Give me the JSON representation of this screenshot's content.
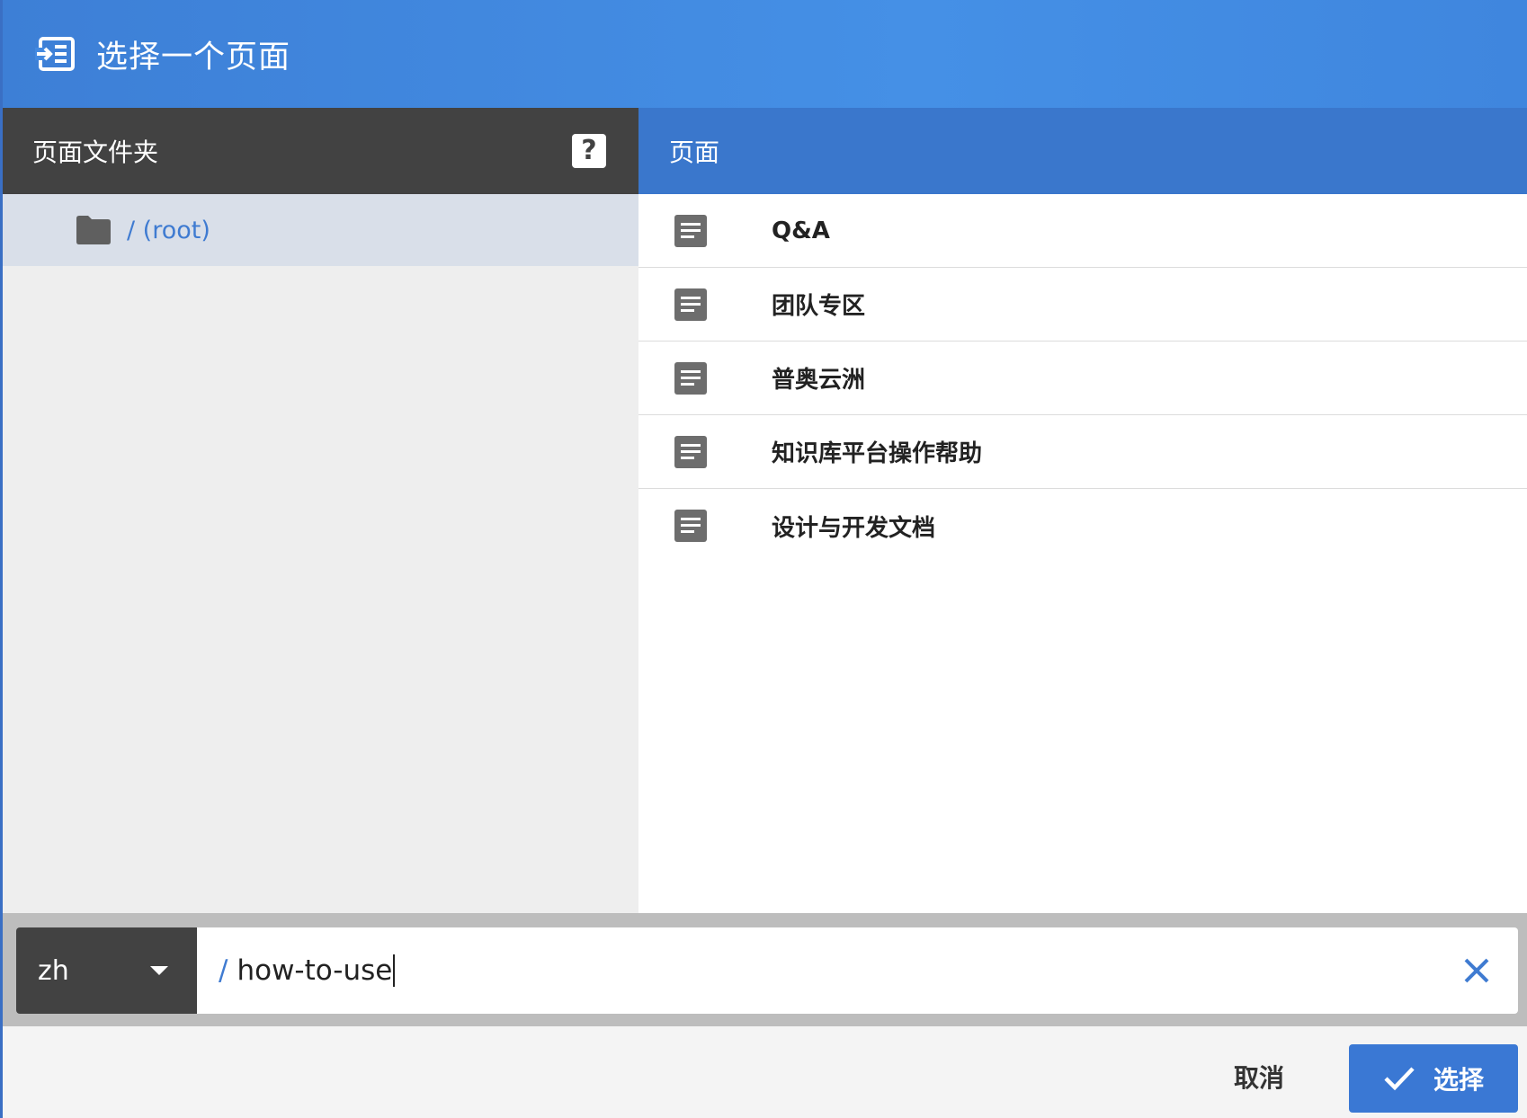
{
  "dialog": {
    "title": "选择一个页面",
    "title_icon": "move-to-folder-icon"
  },
  "folders_panel": {
    "header": "页面文件夹",
    "help_icon": "help-icon",
    "items": [
      {
        "label": "/ (root)",
        "icon": "folder-icon",
        "selected": true
      }
    ]
  },
  "pages_panel": {
    "header": "页面",
    "items": [
      {
        "label": "Q&A",
        "icon": "document-icon"
      },
      {
        "label": "团队专区",
        "icon": "document-icon"
      },
      {
        "label": "普奥云洲",
        "icon": "document-icon"
      },
      {
        "label": "知识库平台操作帮助",
        "icon": "document-icon"
      },
      {
        "label": "设计与开发文档",
        "icon": "document-icon"
      }
    ]
  },
  "path_bar": {
    "locale": "zh",
    "path_prefix": "/",
    "path_value": "how-to-use"
  },
  "footer": {
    "cancel_label": "取消",
    "select_label": "选择"
  },
  "colors": {
    "header_blue": "#3d7fd6",
    "pages_header_blue": "#3a77cc",
    "dark_header": "#424242",
    "accent_blue": "#3f7bd1",
    "selected_row": "#d9dfe9"
  }
}
